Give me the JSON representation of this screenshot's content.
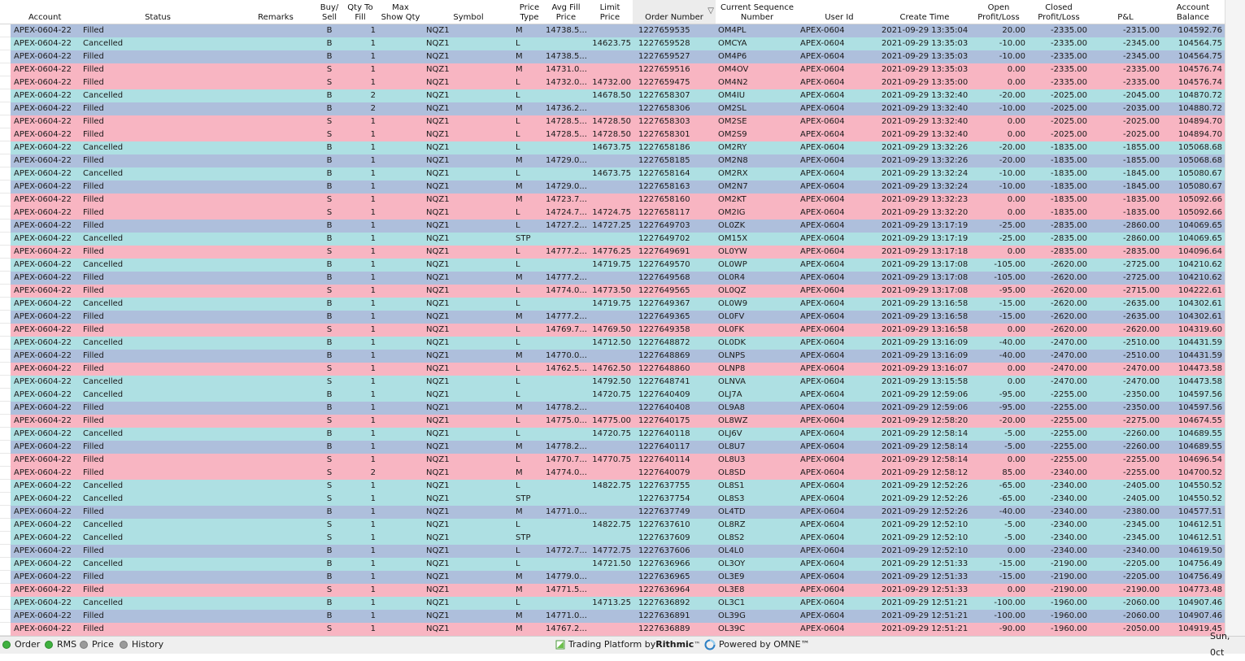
{
  "headers": [
    "Account",
    "Status",
    "Remarks",
    "Buy/\nSell",
    "Qty To\nFill",
    "Max\nShow Qty",
    "Symbol",
    "Price\nType",
    "Avg Fill\nPrice",
    "Limit\nPrice",
    "Order Number",
    "Current Sequence\nNumber",
    "User Id",
    "Create Time",
    "Open\nProfit/Loss",
    "Closed\nProfit/Loss",
    "P&L",
    "Account\nBalance"
  ],
  "sort_indicator": "▽",
  "rows": [
    [
      "APEX-0604-22",
      "Filled",
      "",
      "B",
      "1",
      "",
      "NQZ1",
      "M",
      "14738.5...",
      "",
      "1227659535",
      "OM4PL",
      "APEX-0604",
      "2021-09-29 13:35:04",
      "20.00",
      "-2335.00",
      "-2315.00",
      "104592.76"
    ],
    [
      "APEX-0604-22",
      "Cancelled",
      "",
      "B",
      "1",
      "",
      "NQZ1",
      "L",
      "",
      "14623.75",
      "1227659528",
      "OMCYA",
      "APEX-0604",
      "2021-09-29 13:35:03",
      "-10.00",
      "-2335.00",
      "-2345.00",
      "104564.75"
    ],
    [
      "APEX-0604-22",
      "Filled",
      "",
      "B",
      "1",
      "",
      "NQZ1",
      "M",
      "14738.5...",
      "",
      "1227659527",
      "OM4P6",
      "APEX-0604",
      "2021-09-29 13:35:03",
      "-10.00",
      "-2335.00",
      "-2345.00",
      "104564.75"
    ],
    [
      "APEX-0604-22",
      "Filled",
      "",
      "S",
      "1",
      "",
      "NQZ1",
      "M",
      "14731.0...",
      "",
      "1227659516",
      "OM4OV",
      "APEX-0604",
      "2021-09-29 13:35:03",
      "0.00",
      "-2335.00",
      "-2335.00",
      "104576.74"
    ],
    [
      "APEX-0604-22",
      "Filled",
      "",
      "S",
      "1",
      "",
      "NQZ1",
      "L",
      "14732.0...",
      "14732.00",
      "1227659475",
      "OM4N2",
      "APEX-0604",
      "2021-09-29 13:35:00",
      "0.00",
      "-2335.00",
      "-2335.00",
      "104576.74"
    ],
    [
      "APEX-0604-22",
      "Cancelled",
      "",
      "B",
      "2",
      "",
      "NQZ1",
      "L",
      "",
      "14678.50",
      "1227658307",
      "OM4IU",
      "APEX-0604",
      "2021-09-29 13:32:40",
      "-20.00",
      "-2025.00",
      "-2045.00",
      "104870.72"
    ],
    [
      "APEX-0604-22",
      "Filled",
      "",
      "B",
      "2",
      "",
      "NQZ1",
      "M",
      "14736.2...",
      "",
      "1227658306",
      "OM2SL",
      "APEX-0604",
      "2021-09-29 13:32:40",
      "-10.00",
      "-2025.00",
      "-2035.00",
      "104880.72"
    ],
    [
      "APEX-0604-22",
      "Filled",
      "",
      "S",
      "1",
      "",
      "NQZ1",
      "L",
      "14728.5...",
      "14728.50",
      "1227658303",
      "OM2SE",
      "APEX-0604",
      "2021-09-29 13:32:40",
      "0.00",
      "-2025.00",
      "-2025.00",
      "104894.70"
    ],
    [
      "APEX-0604-22",
      "Filled",
      "",
      "S",
      "1",
      "",
      "NQZ1",
      "L",
      "14728.5...",
      "14728.50",
      "1227658301",
      "OM2S9",
      "APEX-0604",
      "2021-09-29 13:32:40",
      "0.00",
      "-2025.00",
      "-2025.00",
      "104894.70"
    ],
    [
      "APEX-0604-22",
      "Cancelled",
      "",
      "B",
      "1",
      "",
      "NQZ1",
      "L",
      "",
      "14673.75",
      "1227658186",
      "OM2RY",
      "APEX-0604",
      "2021-09-29 13:32:26",
      "-20.00",
      "-1835.00",
      "-1855.00",
      "105068.68"
    ],
    [
      "APEX-0604-22",
      "Filled",
      "",
      "B",
      "1",
      "",
      "NQZ1",
      "M",
      "14729.0...",
      "",
      "1227658185",
      "OM2N8",
      "APEX-0604",
      "2021-09-29 13:32:26",
      "-20.00",
      "-1835.00",
      "-1855.00",
      "105068.68"
    ],
    [
      "APEX-0604-22",
      "Cancelled",
      "",
      "B",
      "1",
      "",
      "NQZ1",
      "L",
      "",
      "14673.75",
      "1227658164",
      "OM2RX",
      "APEX-0604",
      "2021-09-29 13:32:24",
      "-10.00",
      "-1835.00",
      "-1845.00",
      "105080.67"
    ],
    [
      "APEX-0604-22",
      "Filled",
      "",
      "B",
      "1",
      "",
      "NQZ1",
      "M",
      "14729.0...",
      "",
      "1227658163",
      "OM2N7",
      "APEX-0604",
      "2021-09-29 13:32:24",
      "-10.00",
      "-1835.00",
      "-1845.00",
      "105080.67"
    ],
    [
      "APEX-0604-22",
      "Filled",
      "",
      "S",
      "1",
      "",
      "NQZ1",
      "M",
      "14723.7...",
      "",
      "1227658160",
      "OM2KT",
      "APEX-0604",
      "2021-09-29 13:32:23",
      "0.00",
      "-1835.00",
      "-1835.00",
      "105092.66"
    ],
    [
      "APEX-0604-22",
      "Filled",
      "",
      "S",
      "1",
      "",
      "NQZ1",
      "L",
      "14724.7...",
      "14724.75",
      "1227658117",
      "OM2IG",
      "APEX-0604",
      "2021-09-29 13:32:20",
      "0.00",
      "-1835.00",
      "-1835.00",
      "105092.66"
    ],
    [
      "APEX-0604-22",
      "Filled",
      "",
      "B",
      "1",
      "",
      "NQZ1",
      "L",
      "14727.2...",
      "14727.25",
      "1227649703",
      "OL0ZK",
      "APEX-0604",
      "2021-09-29 13:17:19",
      "-25.00",
      "-2835.00",
      "-2860.00",
      "104069.65"
    ],
    [
      "APEX-0604-22",
      "Cancelled",
      "",
      "B",
      "1",
      "",
      "NQZ1",
      "STP",
      "",
      "",
      "1227649702",
      "OM15X",
      "APEX-0604",
      "2021-09-29 13:17:19",
      "-25.00",
      "-2835.00",
      "-2860.00",
      "104069.65"
    ],
    [
      "APEX-0604-22",
      "Filled",
      "",
      "S",
      "1",
      "",
      "NQZ1",
      "L",
      "14777.2...",
      "14776.25",
      "1227649691",
      "OL0YW",
      "APEX-0604",
      "2021-09-29 13:17:18",
      "0.00",
      "-2835.00",
      "-2835.00",
      "104096.64"
    ],
    [
      "APEX-0604-22",
      "Cancelled",
      "",
      "B",
      "1",
      "",
      "NQZ1",
      "L",
      "",
      "14719.75",
      "1227649570",
      "OL0WP",
      "APEX-0604",
      "2021-09-29 13:17:08",
      "-105.00",
      "-2620.00",
      "-2725.00",
      "104210.62"
    ],
    [
      "APEX-0604-22",
      "Filled",
      "",
      "B",
      "1",
      "",
      "NQZ1",
      "M",
      "14777.2...",
      "",
      "1227649568",
      "OL0R4",
      "APEX-0604",
      "2021-09-29 13:17:08",
      "-105.00",
      "-2620.00",
      "-2725.00",
      "104210.62"
    ],
    [
      "APEX-0604-22",
      "Filled",
      "",
      "S",
      "1",
      "",
      "NQZ1",
      "L",
      "14774.0...",
      "14773.50",
      "1227649565",
      "OL0QZ",
      "APEX-0604",
      "2021-09-29 13:17:08",
      "-95.00",
      "-2620.00",
      "-2715.00",
      "104222.61"
    ],
    [
      "APEX-0604-22",
      "Cancelled",
      "",
      "B",
      "1",
      "",
      "NQZ1",
      "L",
      "",
      "14719.75",
      "1227649367",
      "OL0W9",
      "APEX-0604",
      "2021-09-29 13:16:58",
      "-15.00",
      "-2620.00",
      "-2635.00",
      "104302.61"
    ],
    [
      "APEX-0604-22",
      "Filled",
      "",
      "B",
      "1",
      "",
      "NQZ1",
      "M",
      "14777.2...",
      "",
      "1227649365",
      "OL0FV",
      "APEX-0604",
      "2021-09-29 13:16:58",
      "-15.00",
      "-2620.00",
      "-2635.00",
      "104302.61"
    ],
    [
      "APEX-0604-22",
      "Filled",
      "",
      "S",
      "1",
      "",
      "NQZ1",
      "L",
      "14769.7...",
      "14769.50",
      "1227649358",
      "OL0FK",
      "APEX-0604",
      "2021-09-29 13:16:58",
      "0.00",
      "-2620.00",
      "-2620.00",
      "104319.60"
    ],
    [
      "APEX-0604-22",
      "Cancelled",
      "",
      "B",
      "1",
      "",
      "NQZ1",
      "L",
      "",
      "14712.50",
      "1227648872",
      "OL0DK",
      "APEX-0604",
      "2021-09-29 13:16:09",
      "-40.00",
      "-2470.00",
      "-2510.00",
      "104431.59"
    ],
    [
      "APEX-0604-22",
      "Filled",
      "",
      "B",
      "1",
      "",
      "NQZ1",
      "M",
      "14770.0...",
      "",
      "1227648869",
      "OLNPS",
      "APEX-0604",
      "2021-09-29 13:16:09",
      "-40.00",
      "-2470.00",
      "-2510.00",
      "104431.59"
    ],
    [
      "APEX-0604-22",
      "Filled",
      "",
      "S",
      "1",
      "",
      "NQZ1",
      "L",
      "14762.5...",
      "14762.50",
      "1227648860",
      "OLNP8",
      "APEX-0604",
      "2021-09-29 13:16:07",
      "0.00",
      "-2470.00",
      "-2470.00",
      "104473.58"
    ],
    [
      "APEX-0604-22",
      "Cancelled",
      "",
      "S",
      "1",
      "",
      "NQZ1",
      "L",
      "",
      "14792.50",
      "1227648741",
      "OLNVA",
      "APEX-0604",
      "2021-09-29 13:15:58",
      "0.00",
      "-2470.00",
      "-2470.00",
      "104473.58"
    ],
    [
      "APEX-0604-22",
      "Cancelled",
      "",
      "B",
      "1",
      "",
      "NQZ1",
      "L",
      "",
      "14720.75",
      "1227640409",
      "OLJ7A",
      "APEX-0604",
      "2021-09-29 12:59:06",
      "-95.00",
      "-2255.00",
      "-2350.00",
      "104597.56"
    ],
    [
      "APEX-0604-22",
      "Filled",
      "",
      "B",
      "1",
      "",
      "NQZ1",
      "M",
      "14778.2...",
      "",
      "1227640408",
      "OL9A8",
      "APEX-0604",
      "2021-09-29 12:59:06",
      "-95.00",
      "-2255.00",
      "-2350.00",
      "104597.56"
    ],
    [
      "APEX-0604-22",
      "Filled",
      "",
      "S",
      "1",
      "",
      "NQZ1",
      "L",
      "14775.0...",
      "14775.00",
      "1227640175",
      "OL8WZ",
      "APEX-0604",
      "2021-09-29 12:58:20",
      "-20.00",
      "-2255.00",
      "-2275.00",
      "104674.55"
    ],
    [
      "APEX-0604-22",
      "Cancelled",
      "",
      "B",
      "1",
      "",
      "NQZ1",
      "L",
      "",
      "14720.75",
      "1227640118",
      "OLJ6V",
      "APEX-0604",
      "2021-09-29 12:58:14",
      "-5.00",
      "-2255.00",
      "-2260.00",
      "104689.55"
    ],
    [
      "APEX-0604-22",
      "Filled",
      "",
      "B",
      "1",
      "",
      "NQZ1",
      "M",
      "14778.2...",
      "",
      "1227640117",
      "OL8U7",
      "APEX-0604",
      "2021-09-29 12:58:14",
      "-5.00",
      "-2255.00",
      "-2260.00",
      "104689.55"
    ],
    [
      "APEX-0604-22",
      "Filled",
      "",
      "S",
      "1",
      "",
      "NQZ1",
      "L",
      "14770.7...",
      "14770.75",
      "1227640114",
      "OL8U3",
      "APEX-0604",
      "2021-09-29 12:58:14",
      "0.00",
      "-2255.00",
      "-2255.00",
      "104696.54"
    ],
    [
      "APEX-0604-22",
      "Filled",
      "",
      "S",
      "2",
      "",
      "NQZ1",
      "M",
      "14774.0...",
      "",
      "1227640079",
      "OL8SD",
      "APEX-0604",
      "2021-09-29 12:58:12",
      "85.00",
      "-2340.00",
      "-2255.00",
      "104700.52"
    ],
    [
      "APEX-0604-22",
      "Cancelled",
      "",
      "S",
      "1",
      "",
      "NQZ1",
      "L",
      "",
      "14822.75",
      "1227637755",
      "OL8S1",
      "APEX-0604",
      "2021-09-29 12:52:26",
      "-65.00",
      "-2340.00",
      "-2405.00",
      "104550.52"
    ],
    [
      "APEX-0604-22",
      "Cancelled",
      "",
      "S",
      "1",
      "",
      "NQZ1",
      "STP",
      "",
      "",
      "1227637754",
      "OL8S3",
      "APEX-0604",
      "2021-09-29 12:52:26",
      "-65.00",
      "-2340.00",
      "-2405.00",
      "104550.52"
    ],
    [
      "APEX-0604-22",
      "Filled",
      "",
      "B",
      "1",
      "",
      "NQZ1",
      "M",
      "14771.0...",
      "",
      "1227637749",
      "OL4TD",
      "APEX-0604",
      "2021-09-29 12:52:26",
      "-40.00",
      "-2340.00",
      "-2380.00",
      "104577.51"
    ],
    [
      "APEX-0604-22",
      "Cancelled",
      "",
      "S",
      "1",
      "",
      "NQZ1",
      "L",
      "",
      "14822.75",
      "1227637610",
      "OL8RZ",
      "APEX-0604",
      "2021-09-29 12:52:10",
      "-5.00",
      "-2340.00",
      "-2345.00",
      "104612.51"
    ],
    [
      "APEX-0604-22",
      "Cancelled",
      "",
      "S",
      "1",
      "",
      "NQZ1",
      "STP",
      "",
      "",
      "1227637609",
      "OL8S2",
      "APEX-0604",
      "2021-09-29 12:52:10",
      "-5.00",
      "-2340.00",
      "-2345.00",
      "104612.51"
    ],
    [
      "APEX-0604-22",
      "Filled",
      "",
      "B",
      "1",
      "",
      "NQZ1",
      "L",
      "14772.7...",
      "14772.75",
      "1227637606",
      "OL4L0",
      "APEX-0604",
      "2021-09-29 12:52:10",
      "0.00",
      "-2340.00",
      "-2340.00",
      "104619.50"
    ],
    [
      "APEX-0604-22",
      "Cancelled",
      "",
      "B",
      "1",
      "",
      "NQZ1",
      "L",
      "",
      "14721.50",
      "1227636966",
      "OL3OY",
      "APEX-0604",
      "2021-09-29 12:51:33",
      "-15.00",
      "-2190.00",
      "-2205.00",
      "104756.49"
    ],
    [
      "APEX-0604-22",
      "Filled",
      "",
      "B",
      "1",
      "",
      "NQZ1",
      "M",
      "14779.0...",
      "",
      "1227636965",
      "OL3E9",
      "APEX-0604",
      "2021-09-29 12:51:33",
      "-15.00",
      "-2190.00",
      "-2205.00",
      "104756.49"
    ],
    [
      "APEX-0604-22",
      "Filled",
      "",
      "S",
      "1",
      "",
      "NQZ1",
      "M",
      "14771.5...",
      "",
      "1227636964",
      "OL3E8",
      "APEX-0604",
      "2021-09-29 12:51:33",
      "0.00",
      "-2190.00",
      "-2190.00",
      "104773.48"
    ],
    [
      "APEX-0604-22",
      "Cancelled",
      "",
      "B",
      "1",
      "",
      "NQZ1",
      "L",
      "",
      "14713.25",
      "1227636892",
      "OL3C1",
      "APEX-0604",
      "2021-09-29 12:51:21",
      "-100.00",
      "-1960.00",
      "-2060.00",
      "104907.46"
    ],
    [
      "APEX-0604-22",
      "Filled",
      "",
      "B",
      "1",
      "",
      "NQZ1",
      "M",
      "14771.0...",
      "",
      "1227636891",
      "OL39G",
      "APEX-0604",
      "2021-09-29 12:51:21",
      "-100.00",
      "-1960.00",
      "-2060.00",
      "104907.46"
    ],
    [
      "APEX-0604-22",
      "Filled",
      "",
      "S",
      "1",
      "",
      "NQZ1",
      "M",
      "14767.2...",
      "",
      "1227636889",
      "OL39C",
      "APEX-0604",
      "2021-09-29 12:51:21",
      "-90.00",
      "-1960.00",
      "-2050.00",
      "104919.45"
    ]
  ],
  "statusbar": {
    "items": [
      {
        "label": "Order",
        "state": "green"
      },
      {
        "label": "RMS",
        "state": "green"
      },
      {
        "label": "Price",
        "state": "gray"
      },
      {
        "label": "History",
        "state": "gray"
      }
    ],
    "platform_prefix": "Trading Platform by ",
    "platform_brand": "Rithmic",
    "platform_tm": "™",
    "powered": "Powered by OMNE™",
    "date": "Sun, 0ct"
  },
  "colors": {
    "filled_buy_row": "#aebfdc",
    "filled_sell_row": "#f8b5c2",
    "cancelled_row": "#aee0e3",
    "status_on": "#3fb13f",
    "status_off": "#9a9a9a"
  }
}
